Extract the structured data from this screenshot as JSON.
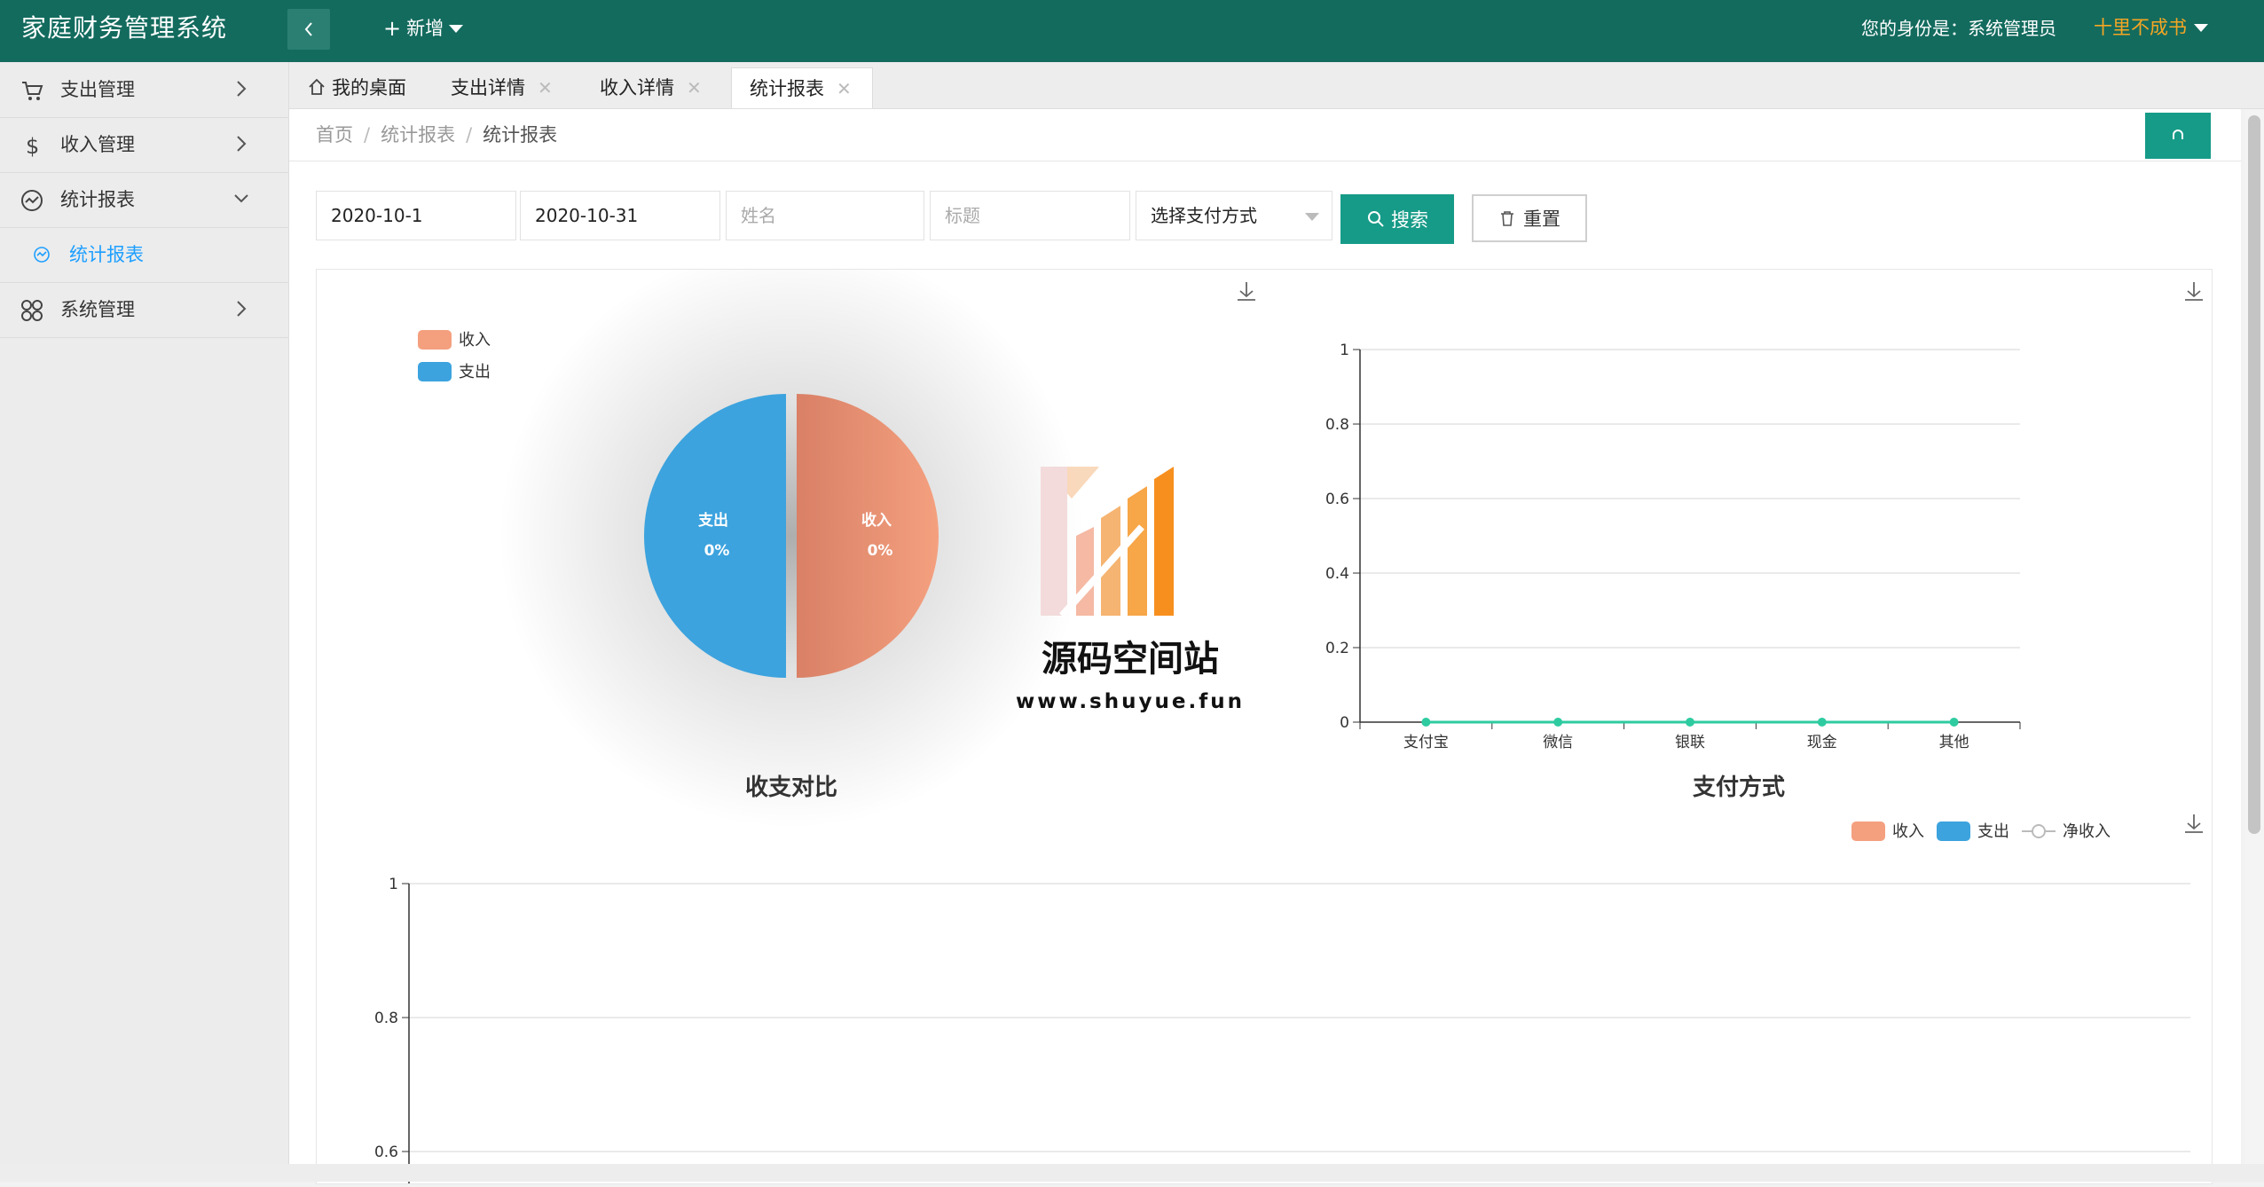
{
  "header": {
    "app_title": "家庭财务管理系统",
    "add_label": "新增",
    "role_text": "您的身份是：系统管理员",
    "user_name": "十里不成书"
  },
  "sidebar": {
    "items": [
      {
        "label": "支出管理",
        "icon": "cart-icon"
      },
      {
        "label": "收入管理",
        "icon": "dollar-icon"
      },
      {
        "label": "统计报表",
        "icon": "chart-line-icon",
        "expanded": true
      },
      {
        "label": "系统管理",
        "icon": "grid-icon"
      }
    ],
    "sub_item": {
      "label": "统计报表",
      "icon": "circle-chart-icon"
    }
  },
  "tabs": [
    {
      "label": "我的桌面",
      "icon": "home-icon"
    },
    {
      "label": "支出详情"
    },
    {
      "label": "收入详情"
    },
    {
      "label": "统计报表",
      "active": true
    }
  ],
  "breadcrumb": {
    "home": "首页",
    "level1": "统计报表",
    "current": "统计报表",
    "separator": "/"
  },
  "filters": {
    "start_date": "2020-10-1",
    "end_date": "2020-10-31",
    "name_placeholder": "姓名",
    "title_placeholder": "标题",
    "payment_select": "选择支付方式",
    "search_label": "搜索",
    "reset_label": "重置"
  },
  "watermark": {
    "name": "源码空间站",
    "url": "www.shuyue.fun"
  },
  "colors": {
    "header": "#136b5e",
    "primary": "#169b88",
    "income": "#f4a07f",
    "expense": "#3ca3de",
    "line": "#2ecba0",
    "accent": "#f5a623"
  },
  "chart_data": [
    {
      "type": "pie",
      "title": "收支对比",
      "legend": [
        "收入",
        "支出"
      ],
      "slices": [
        {
          "name": "收入",
          "value": 0,
          "label": "0%"
        },
        {
          "name": "支出",
          "value": 0,
          "label": "0%"
        }
      ]
    },
    {
      "type": "line",
      "title": "支付方式",
      "categories": [
        "支付宝",
        "微信",
        "银联",
        "现金",
        "其他"
      ],
      "values": [
        0,
        0,
        0,
        0,
        0
      ],
      "ylim": [
        0,
        1
      ],
      "yticks": [
        "0",
        "0.2",
        "0.4",
        "0.6",
        "0.8",
        "1"
      ]
    },
    {
      "type": "bar",
      "legend": [
        "收入",
        "支出",
        "净收入"
      ],
      "series": [
        {
          "name": "收入",
          "values": []
        },
        {
          "name": "支出",
          "values": []
        },
        {
          "name": "净收入",
          "values": []
        }
      ],
      "ylim": [
        0,
        1
      ],
      "yticks_visible": [
        "1",
        "0.8",
        "0.6"
      ]
    }
  ]
}
